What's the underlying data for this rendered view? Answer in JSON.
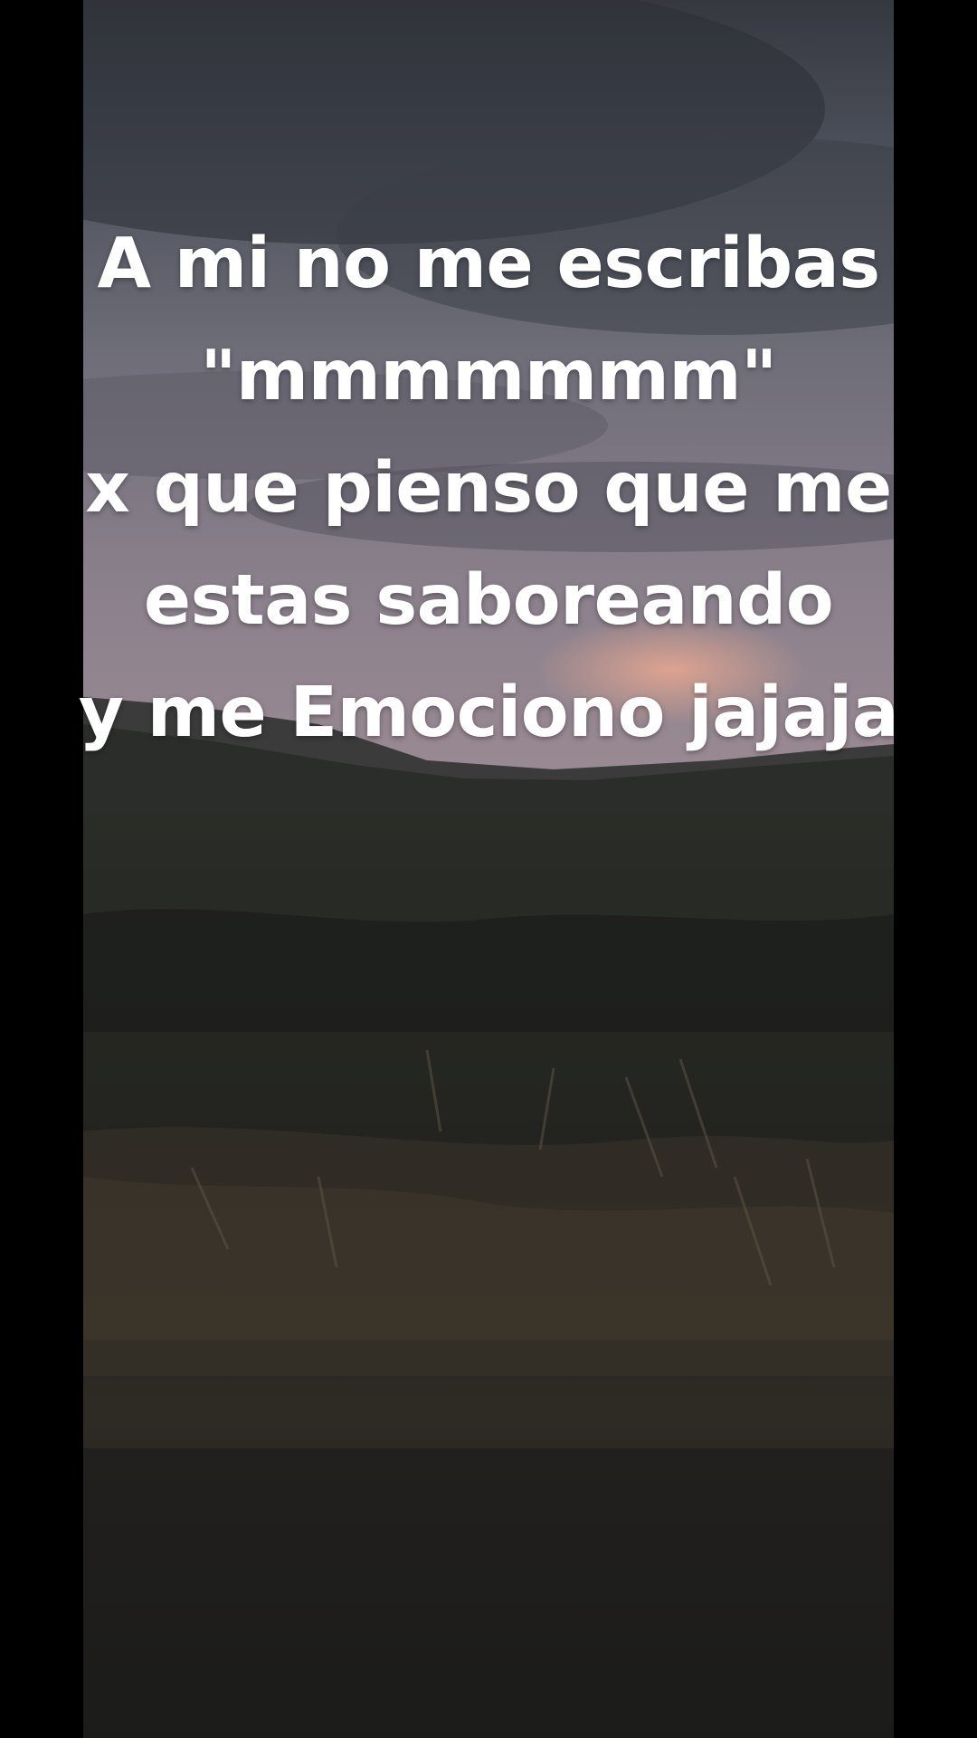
{
  "caption": {
    "lines": [
      "A mi no me escribas",
      "\"mmmmmmm\"",
      "x que pienso que me ",
      "estas saboreando",
      "y me Emociono jajaja"
    ]
  },
  "colors": {
    "letterbox": "#000000",
    "caption_text": "#ffffff",
    "sky_top": "#3a3d44",
    "sky_horizon": "#8a808c",
    "glow": "#d89a86",
    "ground": "#262722"
  }
}
